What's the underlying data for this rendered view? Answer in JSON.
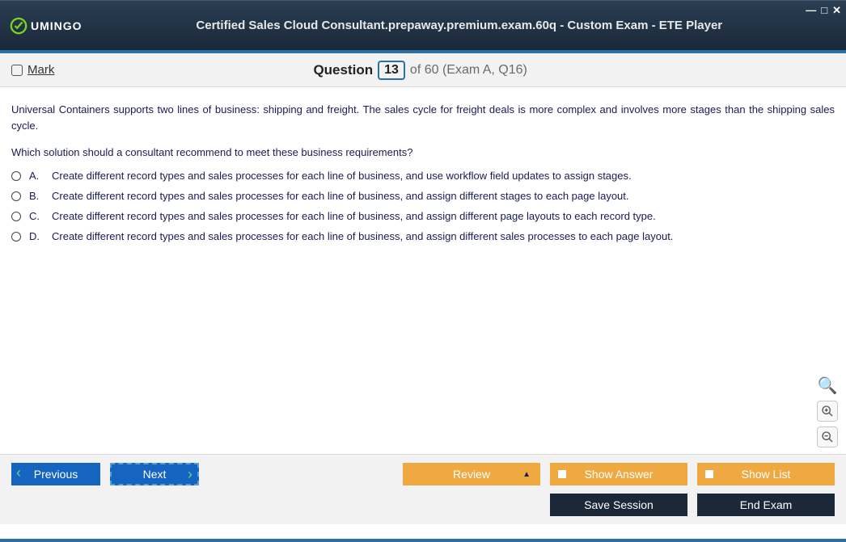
{
  "logo_text": "UMINGO",
  "title": "Certified Sales Cloud Consultant.prepaway.premium.exam.60q - Custom Exam - ETE Player",
  "mark_label": "Mark",
  "question_word": "Question",
  "question_num": "13",
  "question_rest": "of 60 (Exam A, Q16)",
  "stem": "Universal Containers supports two lines of business: shipping and freight. The sales cycle for freight deals is more complex and involves more stages than the shipping sales cycle.",
  "prompt": "Which solution should a consultant recommend to meet these business requirements?",
  "options": [
    {
      "letter": "A.",
      "text": "Create different record types and sales processes for each line of business, and use workflow field updates to assign stages."
    },
    {
      "letter": "B.",
      "text": "Create different record types and sales processes for each line of business, and assign different stages to each page layout."
    },
    {
      "letter": "C.",
      "text": "Create different record types and sales processes for each line of business, and assign different page layouts to each record type."
    },
    {
      "letter": "D.",
      "text": "Create different record types and sales processes for each line of business, and assign different sales processes to each page layout."
    }
  ],
  "buttons": {
    "previous": "Previous",
    "next": "Next",
    "review": "Review",
    "show_answer": "Show Answer",
    "show_list": "Show List",
    "save_session": "Save Session",
    "end_exam": "End Exam"
  }
}
